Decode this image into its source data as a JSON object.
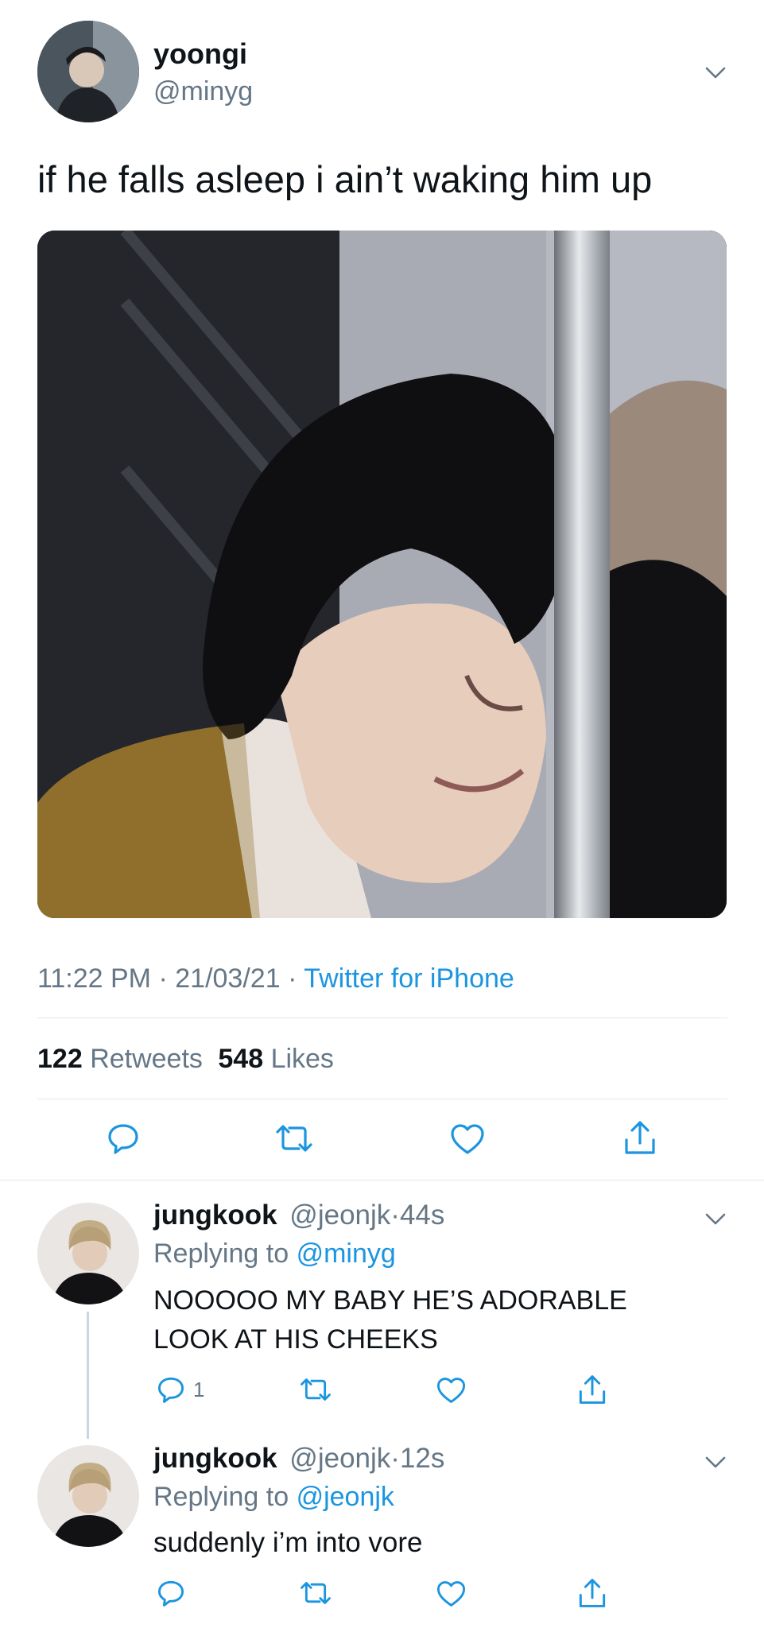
{
  "tweet": {
    "author_name": "yoongi",
    "author_handle": "@minyg",
    "text": "if he falls asleep i ain’t waking him up",
    "time": "11:22 PM",
    "date": "21/03/21",
    "separator": "·",
    "source": "Twitter for iPhone",
    "retweets_count": "122",
    "retweets_label": "Retweets",
    "likes_count": "548",
    "likes_label": "Likes"
  },
  "replies": [
    {
      "author_name": "jungkook",
      "author_handle": "@jeonjk",
      "time_ago": "44s",
      "replying_prefix": "Replying to",
      "replying_to": "@minyg",
      "text_line1": "NOOOOO MY BABY HE’S ADORABLE",
      "text_line2": "LOOK AT HIS CHEEKS",
      "reply_count": "1"
    },
    {
      "author_name": "jungkook",
      "author_handle": "@jeonjk",
      "time_ago": "12s",
      "replying_prefix": "Replying to",
      "replying_to": "@jeonjk",
      "text": "suddenly i’m into vore"
    }
  ],
  "icons": {
    "reply": "speech-bubble-icon",
    "retweet": "retweet-arrows-icon",
    "like": "heart-outline-icon",
    "share": "share-upload-icon",
    "more": "chevron-down-icon"
  },
  "colors": {
    "link": "#1b95e0",
    "muted": "#657786",
    "divider": "#e1e8ed",
    "text": "#0f1419"
  }
}
